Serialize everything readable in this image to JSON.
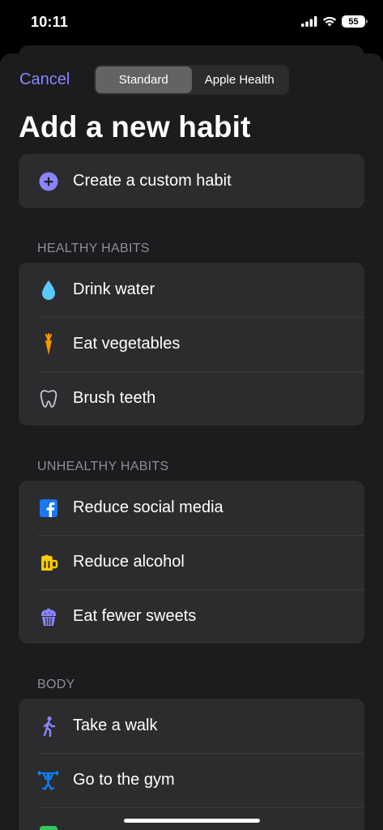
{
  "status_bar": {
    "time": "10:11",
    "battery": "55"
  },
  "nav": {
    "cancel_label": "Cancel",
    "segments": [
      {
        "label": "Standard",
        "selected": true
      },
      {
        "label": "Apple Health",
        "selected": false
      }
    ]
  },
  "title": "Add a new habit",
  "custom": {
    "label": "Create a custom habit",
    "icon": "plus-circle-icon"
  },
  "sections": [
    {
      "header": "HEALTHY HABITS",
      "items": [
        {
          "label": "Drink water",
          "icon": "water-drop-icon"
        },
        {
          "label": "Eat vegetables",
          "icon": "carrot-icon"
        },
        {
          "label": "Brush teeth",
          "icon": "tooth-icon"
        }
      ]
    },
    {
      "header": "UNHEALTHY HABITS",
      "items": [
        {
          "label": "Reduce social media",
          "icon": "facebook-icon"
        },
        {
          "label": "Reduce alcohol",
          "icon": "beer-mug-icon"
        },
        {
          "label": "Eat fewer sweets",
          "icon": "cupcake-icon"
        }
      ]
    },
    {
      "header": "BODY",
      "items": [
        {
          "label": "Take a walk",
          "icon": "walking-figure-icon"
        },
        {
          "label": "Go to the gym",
          "icon": "weightlifter-icon"
        }
      ]
    }
  ],
  "colors": {
    "accent": "#8a84ff",
    "background": "#1c1c1e",
    "card": "#2c2c2e",
    "water": "#5ac8fa",
    "carrot": "#ff9500",
    "facebook": "#1877f2",
    "beer": "#ffcc00",
    "walk": "#8a84ff",
    "gym": "#0a84ff"
  }
}
